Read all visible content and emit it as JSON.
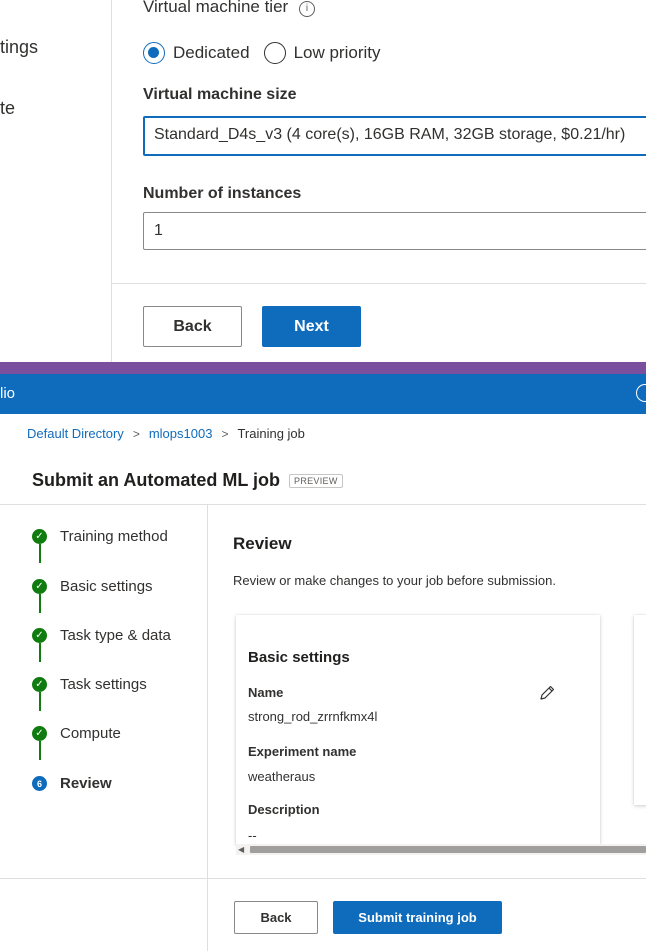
{
  "top": {
    "sidebar_fragments": [
      "tings",
      "te"
    ],
    "vm_tier_label": "Virtual machine tier",
    "info_glyph": "i",
    "radio_options": [
      {
        "label": "Dedicated",
        "checked": true
      },
      {
        "label": "Low priority",
        "checked": false
      }
    ],
    "vm_size_label": "Virtual machine size",
    "vm_size_value": "Standard_D4s_v3 (4 core(s), 16GB RAM, 32GB storage, $0.21/hr)",
    "instances_label": "Number of instances",
    "instances_value": "1",
    "back_label": "Back",
    "next_label": "Next"
  },
  "bottom": {
    "appbar_title_fragment": "lio",
    "breadcrumb": {
      "items": [
        "Default Directory",
        "mlops1003",
        "Training job"
      ],
      "separator": ">"
    },
    "page_title": "Submit an Automated ML job",
    "preview_badge": "PREVIEW",
    "steps": [
      {
        "label": "Training method",
        "status": "complete"
      },
      {
        "label": "Basic settings",
        "status": "complete"
      },
      {
        "label": "Task type & data",
        "status": "complete"
      },
      {
        "label": "Task settings",
        "status": "complete"
      },
      {
        "label": "Compute",
        "status": "complete"
      },
      {
        "label": "Review",
        "status": "current",
        "number": "6"
      }
    ],
    "check_glyph": "✓",
    "review_title": "Review",
    "review_subtitle": "Review or make changes to your job before submission.",
    "card": {
      "title": "Basic settings",
      "fields": [
        {
          "label": "Name",
          "value": "strong_rod_zrrnfkmx4l"
        },
        {
          "label": "Experiment name",
          "value": "weatheraus"
        },
        {
          "label": "Description",
          "value": "--"
        }
      ]
    },
    "scroll_arrow": "◀",
    "back_label": "Back",
    "submit_label": "Submit training job"
  },
  "colors": {
    "primary": "#0f6cbd",
    "success": "#107c10",
    "band": "#7a4f9e"
  }
}
